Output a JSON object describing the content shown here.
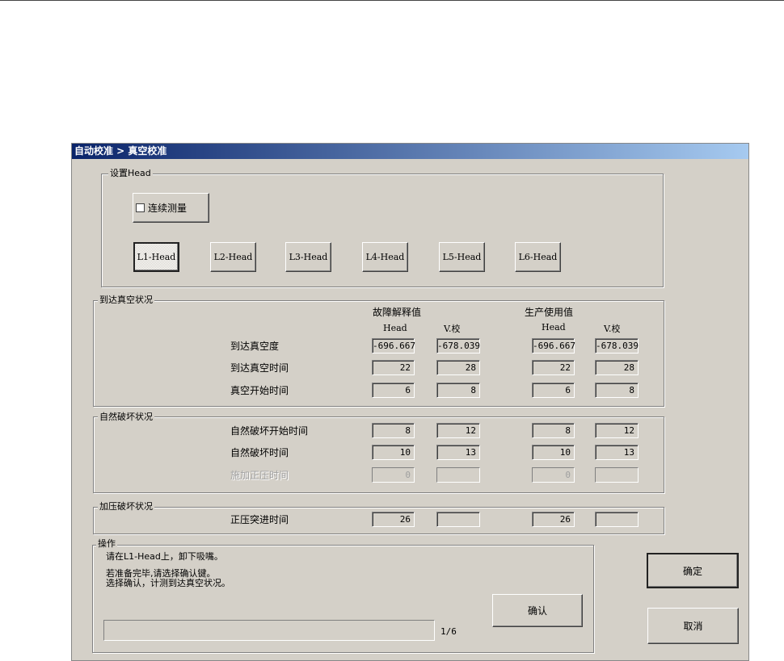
{
  "title": "自动校准 > 真空校准",
  "setup_group": {
    "label": "设置Head",
    "continuous_label": "连续测量",
    "continuous_checked": false,
    "heads": [
      "L1-Head",
      "L2-Head",
      "L3-Head",
      "L4-Head",
      "L5-Head",
      "L6-Head"
    ],
    "selected_head": "L1-Head"
  },
  "columns": {
    "group1": "故障解释值",
    "group2": "生产使用值",
    "head": "Head",
    "vcal": "V.校"
  },
  "vacuum_group": {
    "label": "到达真空状况",
    "rows": [
      {
        "label": "到达真空度",
        "values": [
          "-696.667",
          "-678.039",
          "-696.667",
          "-678.039"
        ],
        "disabled": false
      },
      {
        "label": "到达真空时间",
        "values": [
          "22",
          "28",
          "22",
          "28"
        ],
        "disabled": false
      },
      {
        "label": "真空开始时间",
        "values": [
          "6",
          "8",
          "6",
          "8"
        ],
        "disabled": false
      }
    ]
  },
  "natural_group": {
    "label": "自然破坏状况",
    "rows": [
      {
        "label": "自然破坏开始时间",
        "values": [
          "8",
          "12",
          "8",
          "12"
        ],
        "disabled": false
      },
      {
        "label": "自然破坏时间",
        "values": [
          "10",
          "13",
          "10",
          "13"
        ],
        "disabled": false
      },
      {
        "label": "施加正压时间",
        "values": [
          "0",
          "",
          "0",
          ""
        ],
        "disabled": true
      }
    ]
  },
  "pressure_group": {
    "label": "加压破坏状况",
    "rows": [
      {
        "label": "正压突进时间",
        "values": [
          "26",
          "",
          "26",
          ""
        ],
        "disabled": false
      }
    ]
  },
  "operation": {
    "label": "操作",
    "line1": "请在L1-Head上，卸下吸嘴。",
    "line2": "若准备完毕,请选择确认键。",
    "line3": "选择确认，计测到达真空状况。",
    "progress": 0,
    "step": "1/6",
    "confirm_label": "确认"
  },
  "ok_label": "确定",
  "cancel_label": "取消"
}
